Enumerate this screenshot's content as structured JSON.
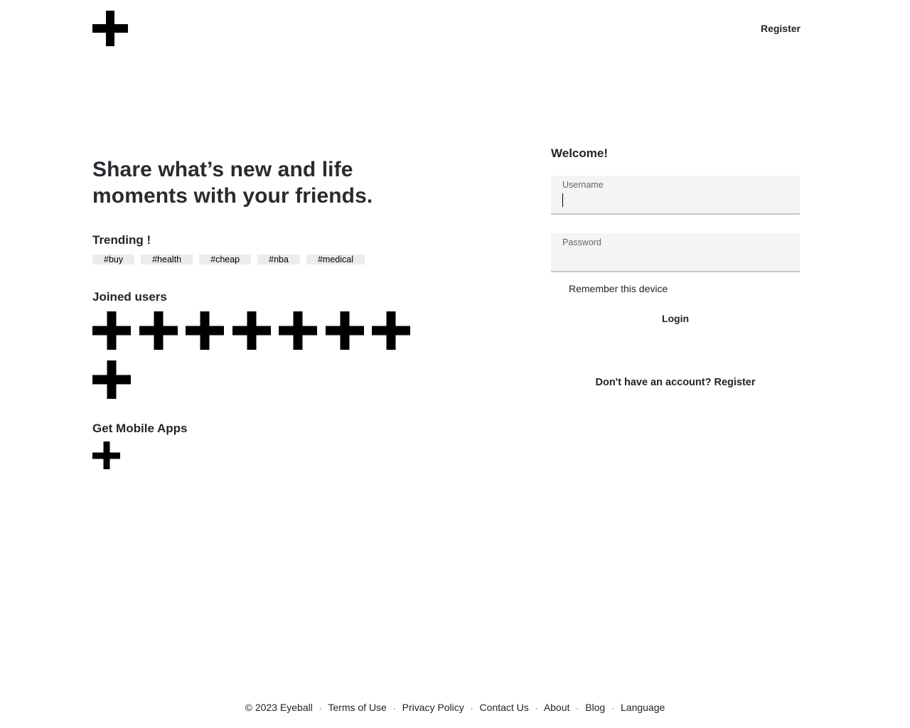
{
  "header": {
    "logo_icon": "plus-icon",
    "register_label": "Register"
  },
  "hero": {
    "headline": "Share what’s new and life moments with your friends."
  },
  "trending": {
    "title": "Trending !",
    "tags": [
      "#buy",
      "#health",
      "#cheap",
      "#nba",
      "#medical"
    ]
  },
  "joined_users": {
    "title": "Joined users",
    "avatar_icon": "plus-icon",
    "count": 8
  },
  "mobile_apps": {
    "title": "Get Mobile Apps",
    "app_icon": "plus-icon"
  },
  "login": {
    "welcome": "Welcome!",
    "username_label": "Username",
    "username_value": "",
    "password_label": "Password",
    "password_value": "",
    "remember_label": "Remember this device",
    "login_label": "Login",
    "signup_text": "Don't have an account? Register"
  },
  "footer": {
    "copyright": "© 2023 Eyeball",
    "links": [
      "Terms of Use",
      "Privacy Policy",
      "Contact Us",
      "About",
      "Blog",
      "Language"
    ]
  }
}
